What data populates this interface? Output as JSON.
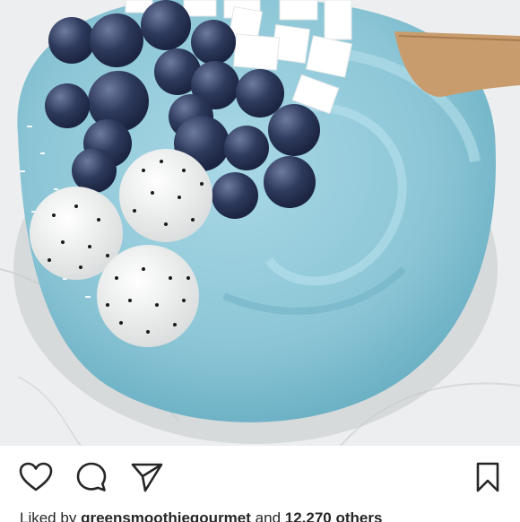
{
  "post": {
    "image_alt": "",
    "colors": {
      "smoothie": "#8cc6d6",
      "smoothie_shadow": "#5ea7bd",
      "blueberry": "#2e3a5c",
      "dragonfruit": "#f4f4f2",
      "coconut": "#ffffff",
      "marble": "#eceeef",
      "spoon": "#c89c6c"
    }
  },
  "actions": {
    "like_icon": "heart-icon",
    "comment_icon": "comment-icon",
    "share_icon": "paper-plane-icon",
    "save_icon": "bookmark-icon"
  },
  "caption": {
    "liked_by_label": "Liked by",
    "username": "greensmoothiegourmet",
    "and_label": "and",
    "others": "12,270 others"
  }
}
